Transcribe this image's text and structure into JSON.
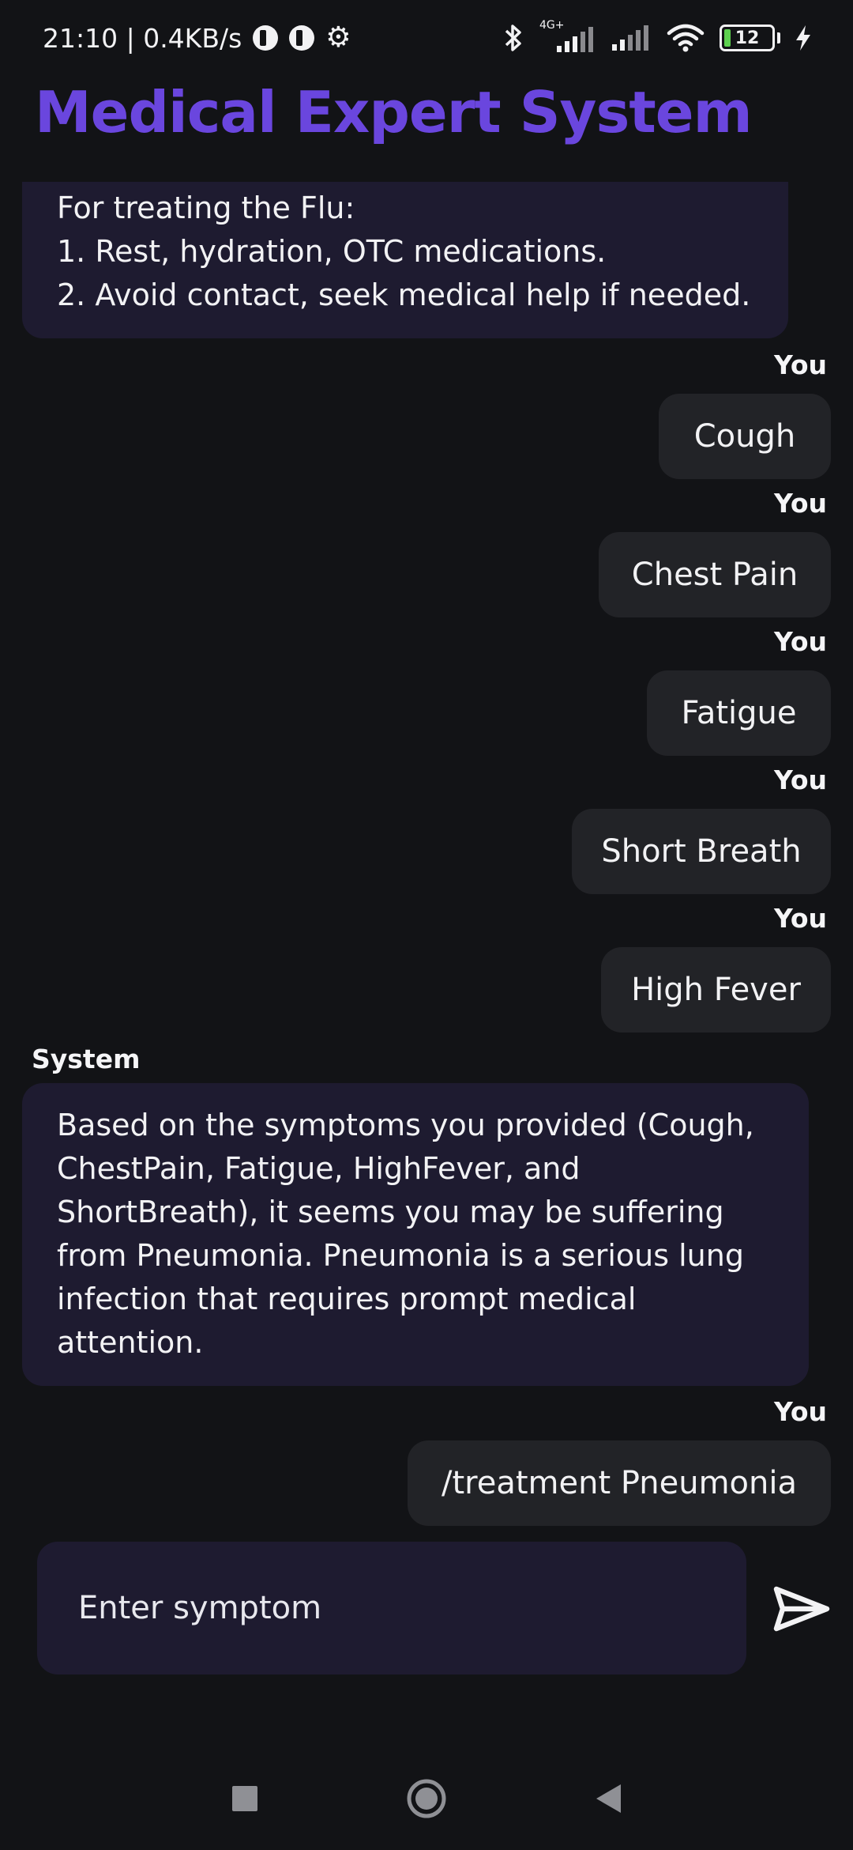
{
  "status_bar": {
    "time_speed": "21:10 | 0.4KB/s",
    "network_label": "4G+",
    "battery_level": "12",
    "icons": [
      "app-icon",
      "app-icon",
      "gear-icon",
      "bluetooth-icon",
      "signal-icon",
      "signal-icon",
      "wifi-icon",
      "battery-icon",
      "charging-bolt-icon"
    ]
  },
  "header": {
    "title": "Medical Expert System"
  },
  "chat": {
    "flu_treatment": {
      "lines": [
        "For treating the Flu:",
        "1. Rest, hydration, OTC medications.",
        "2. Avoid contact, seek medical help if needed."
      ]
    },
    "user_label": "You",
    "system_label": "System",
    "user_messages": [
      "Cough",
      "Chest Pain",
      "Fatigue",
      "Short Breath",
      "High Fever"
    ],
    "system_diagnosis": "Based on the symptoms you provided (Cough, ChestPain, Fatigue, HighFever, and ShortBreath), it seems you may be suffering from Pneumonia. Pneumonia is a serious lung infection that requires prompt medical attention.",
    "last_user_message": "/treatment Pneumonia"
  },
  "input": {
    "placeholder": "Enter symptom",
    "value": ""
  },
  "colors": {
    "accent": "#6a46de",
    "background": "#121316",
    "system_bubble": "#1e1b30",
    "user_bubble": "#222327"
  },
  "nav": {
    "icons": [
      "recent-apps-icon",
      "home-icon",
      "back-icon"
    ]
  }
}
